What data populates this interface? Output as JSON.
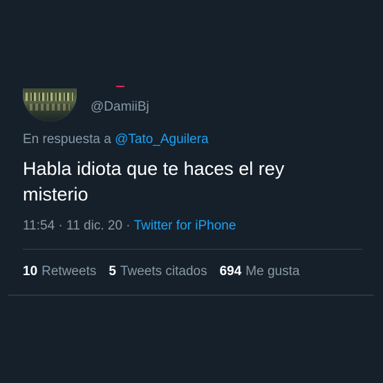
{
  "tweet": {
    "handle": "@DamiiBj",
    "reply_prefix": "En respuesta a ",
    "reply_mention": "@Tato_Aguilera",
    "text": "Habla idiota que te haces el rey misterio",
    "time": "11:54",
    "separator": " · ",
    "date": "11 dic. 20",
    "source": "Twitter for iPhone"
  },
  "stats": {
    "retweets_count": "10",
    "retweets_label": "Retweets",
    "quotes_count": "5",
    "quotes_label": "Tweets citados",
    "likes_count": "694",
    "likes_label": "Me gusta"
  },
  "colors": {
    "background": "#15202b",
    "text_primary": "#ffffff",
    "text_secondary": "#8899a6",
    "accent": "#1da1f2",
    "divider": "#38444d"
  }
}
